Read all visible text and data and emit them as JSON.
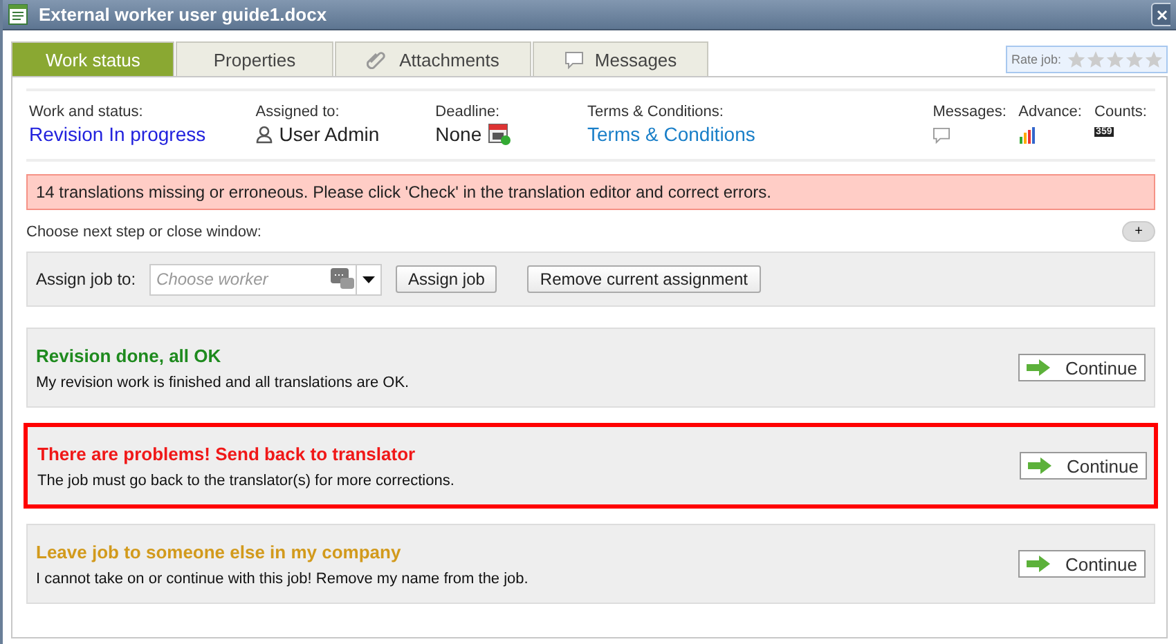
{
  "window": {
    "title": "External worker user guide1.docx"
  },
  "tabs": [
    {
      "label": "Work status",
      "selected": true,
      "kind": "plain"
    },
    {
      "label": "Properties",
      "selected": false,
      "kind": "plain"
    },
    {
      "label": "Attachments",
      "selected": false,
      "kind": "attachments"
    },
    {
      "label": "Messages",
      "selected": false,
      "kind": "messages"
    }
  ],
  "rating": {
    "label": "Rate job:",
    "stars": 0
  },
  "info": [
    {
      "kind": "link",
      "label": "Work and status:",
      "value": "Revision In progress",
      "color": "#2222dd"
    },
    {
      "kind": "user",
      "label": "Assigned to:",
      "value": "User Admin"
    },
    {
      "kind": "deadline",
      "label": "Deadline:",
      "value": "None"
    },
    {
      "kind": "link",
      "label": "Terms & Conditions:",
      "value": "Terms & Conditions",
      "color": "#1a7fc8"
    }
  ],
  "indicators": [
    {
      "kind": "messages",
      "label": "Messages:"
    },
    {
      "kind": "advance",
      "label": "Advance:"
    },
    {
      "kind": "counts",
      "label": "Counts:",
      "badge": "359"
    }
  ],
  "alert": "14 translations missing or erroneous. Please click 'Check' in the translation editor and correct errors.",
  "next_step": {
    "label": "Choose next step or close window:",
    "expand": "+"
  },
  "assign": {
    "label": "Assign job to:",
    "placeholder": "Choose worker",
    "assign_button": "Assign job",
    "remove_button": "Remove current assignment"
  },
  "options": [
    {
      "title": "Revision done, all OK",
      "description": "My revision work is finished and all translations are OK.",
      "color": "#1e8a1e",
      "highlighted": false,
      "button": "Continue"
    },
    {
      "title": "There are problems! Send back to translator",
      "description": "The job must go back to the translator(s) for more corrections.",
      "color": "#f01818",
      "highlighted": true,
      "button": "Continue"
    },
    {
      "title": "Leave job to someone else in my company",
      "description": "I cannot take on or continue with this job! Remove my name from the job.",
      "color": "#d29a1c",
      "highlighted": false,
      "button": "Continue"
    }
  ]
}
